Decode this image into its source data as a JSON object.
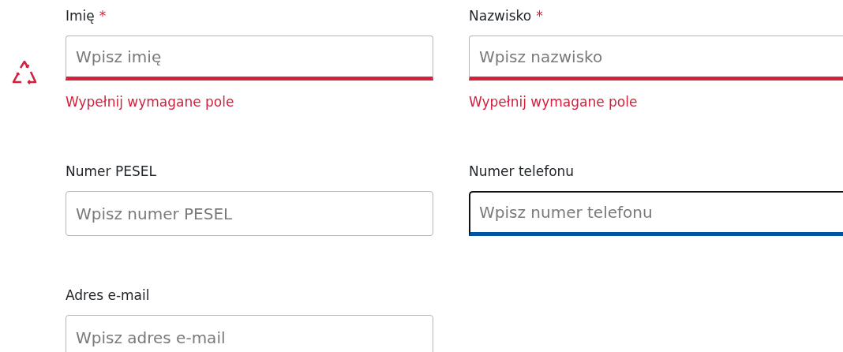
{
  "fields": [
    {
      "label": "Imię",
      "required_mark": "*",
      "placeholder": "Wpisz imię",
      "invalid": true,
      "focused": false,
      "error": "Wypełnij wymagane pole"
    },
    {
      "label": "Nazwisko",
      "required_mark": "*",
      "placeholder": "Wpisz nazwisko",
      "invalid": true,
      "focused": false,
      "error": "Wypełnij wymagane pole"
    },
    {
      "label": "Numer PESEL",
      "placeholder": "Wpisz numer PESEL",
      "invalid": false,
      "focused": false
    },
    {
      "label": "Numer telefonu",
      "placeholder": "Wpisz numer telefonu",
      "invalid": false,
      "focused": true
    },
    {
      "label": "Adres e-mail",
      "placeholder": "Wpisz adres e-mail",
      "invalid": false,
      "focused": false
    }
  ]
}
